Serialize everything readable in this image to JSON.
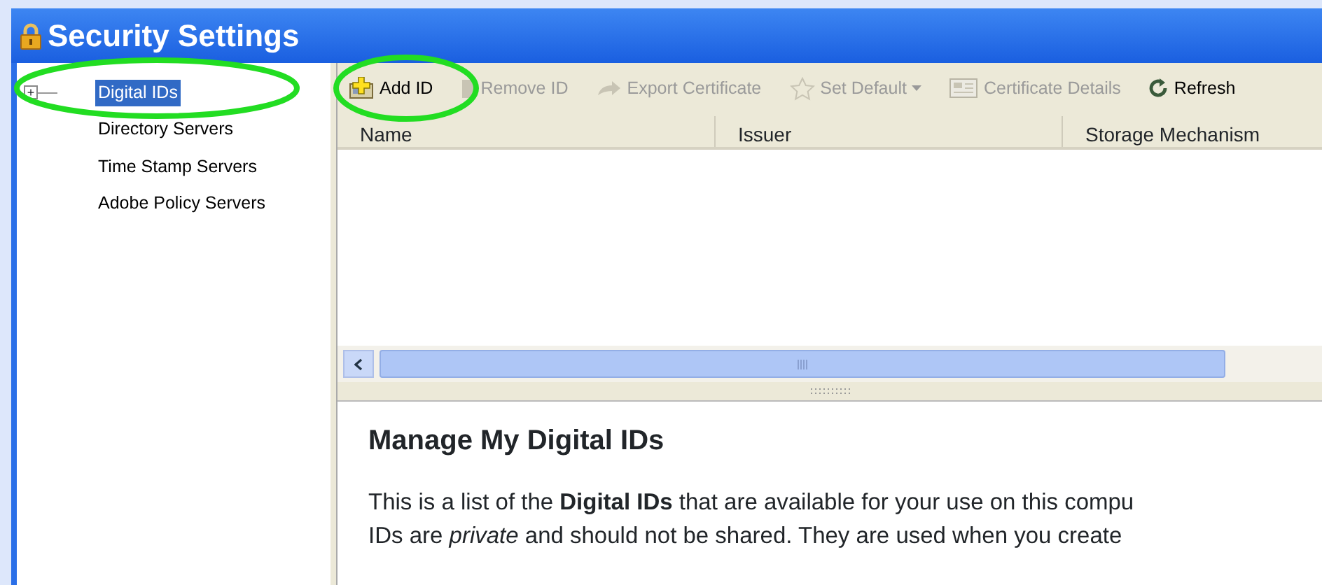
{
  "window": {
    "title": "Security Settings"
  },
  "sidebar": {
    "items": [
      {
        "label": "Digital IDs",
        "selected": true,
        "toggle": "+"
      },
      {
        "label": "Directory Servers",
        "selected": false
      },
      {
        "label": "Time Stamp Servers",
        "selected": false
      },
      {
        "label": "Adobe Policy Servers",
        "selected": false
      }
    ]
  },
  "toolbar": [
    {
      "label": "Add ID",
      "kind": "add",
      "disabled": false
    },
    {
      "label": "Remove ID",
      "kind": "remove",
      "disabled": true
    },
    {
      "label": "Export Certificate",
      "kind": "export",
      "disabled": true
    },
    {
      "label": "Set Default",
      "kind": "star",
      "disabled": true,
      "dropdown": true
    },
    {
      "label": "Certificate Details",
      "kind": "details",
      "disabled": true
    },
    {
      "label": "Refresh",
      "kind": "refresh",
      "disabled": false
    }
  ],
  "table": {
    "columns": [
      "Name",
      "Issuer",
      "Storage Mechanism"
    ]
  },
  "details": {
    "heading": "Manage My Digital IDs",
    "lines": [
      "This is a list of the **Digital IDs** that are available for your use on this compu",
      "IDs are *private* and should not be shared. They are used when you create"
    ]
  },
  "annotations": [
    {
      "kind": "ellipse"
    },
    {
      "kind": "ellipse"
    }
  ]
}
